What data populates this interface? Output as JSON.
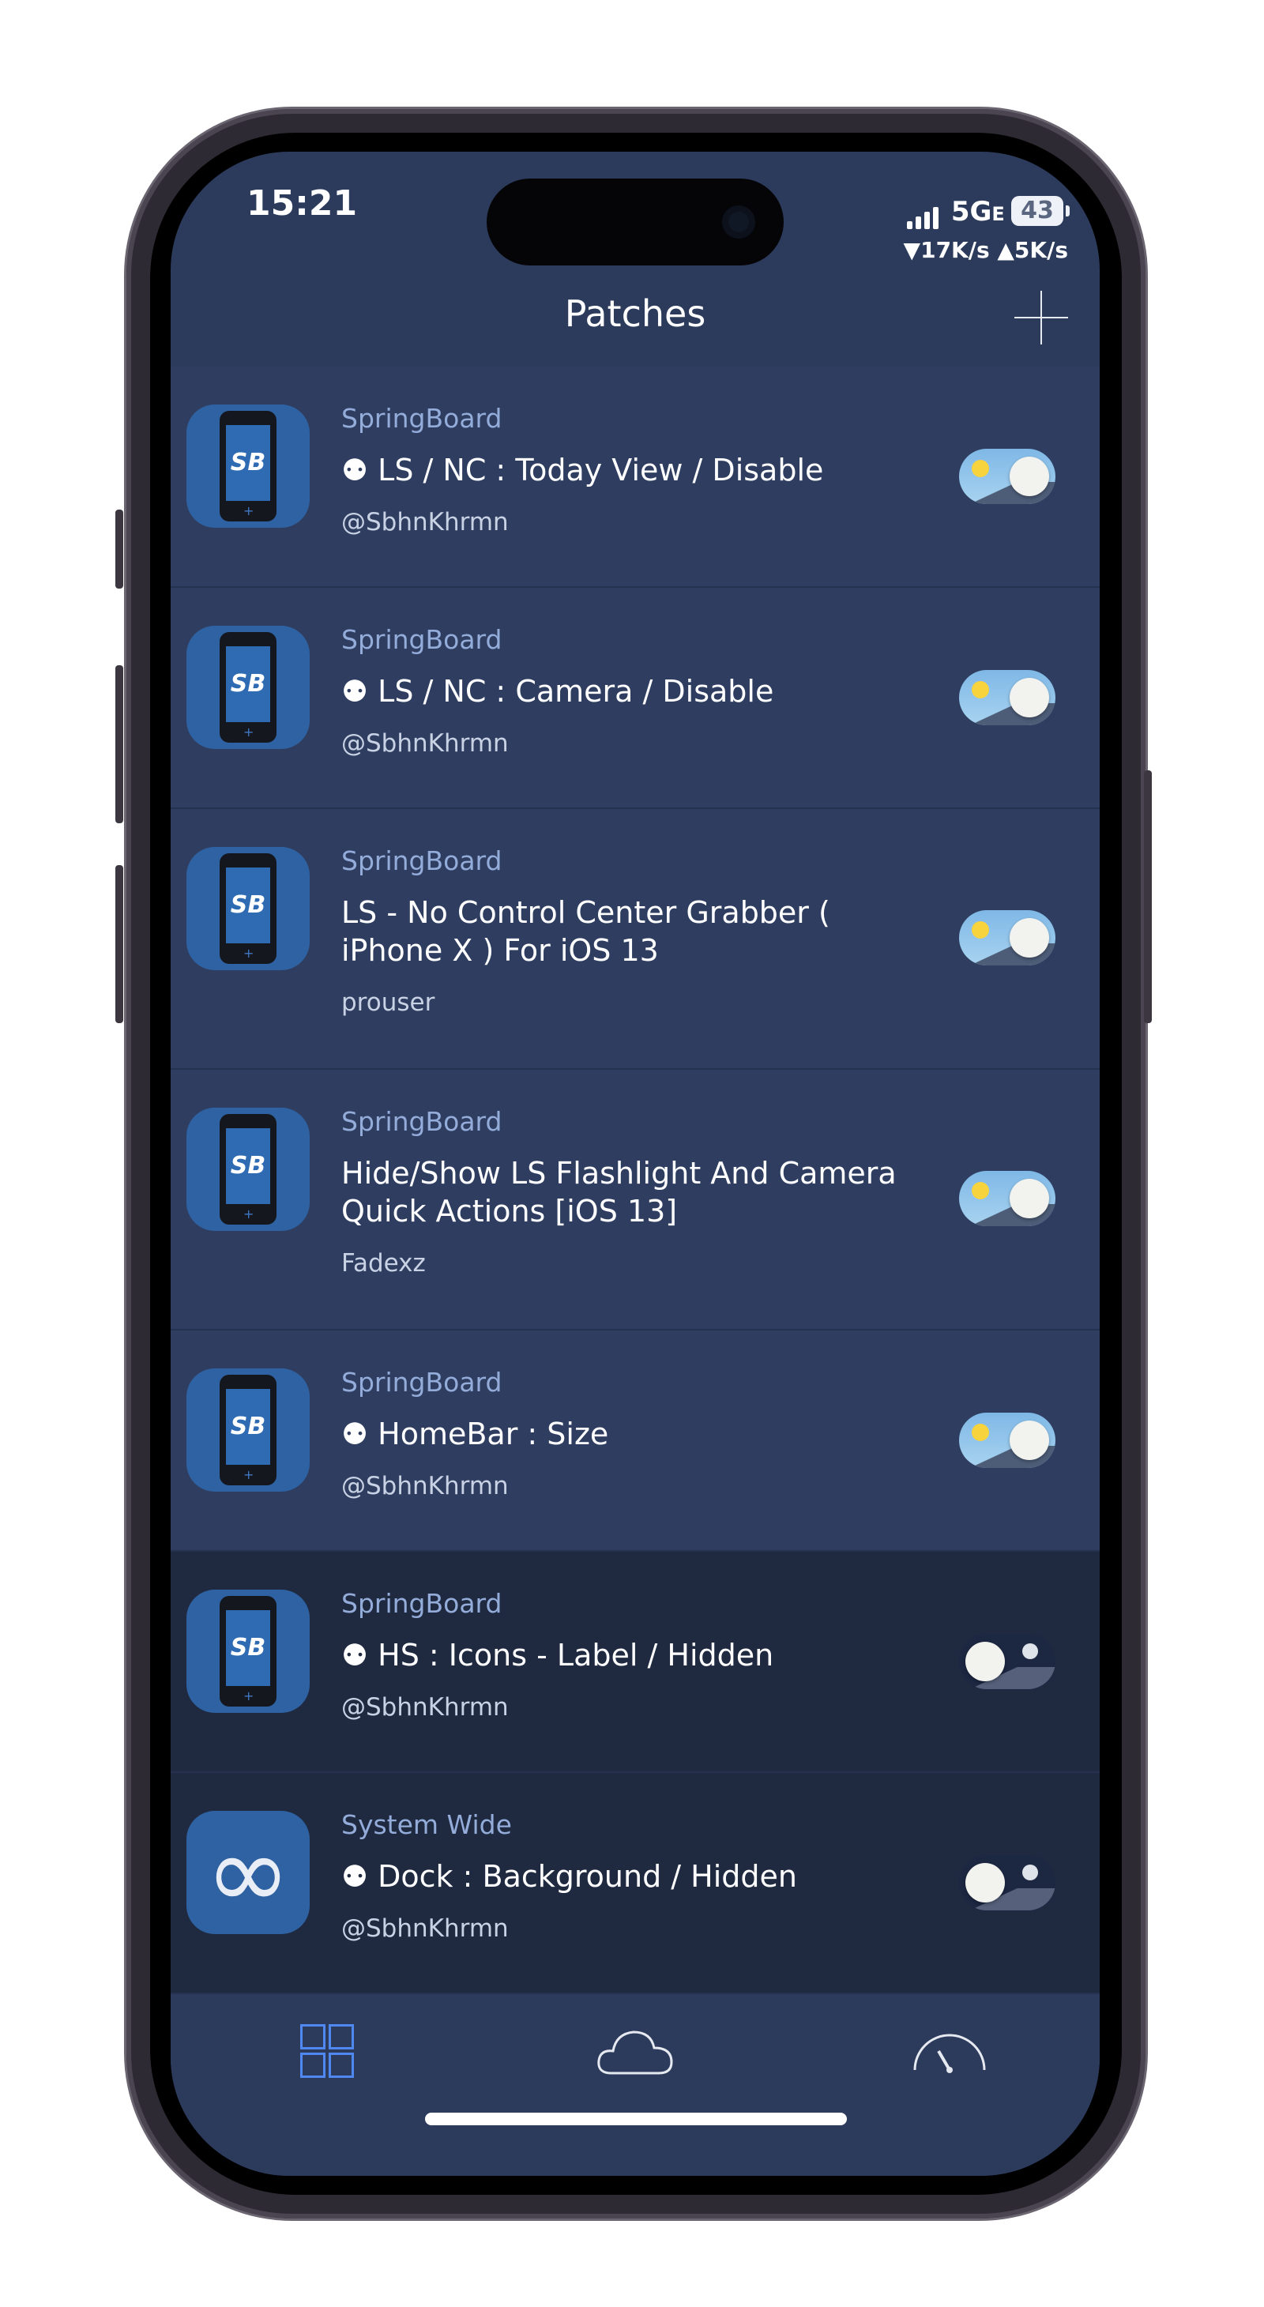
{
  "status": {
    "time": "15:21",
    "network": "5G",
    "network_sub": "E",
    "battery": "43",
    "speed": "▼17K/s ▲5K/s"
  },
  "header": {
    "title": "Patches",
    "add_icon": "plus-icon"
  },
  "patches": [
    {
      "category": "SpringBoard",
      "name": "⚉ LS / NC : Today View / Disable",
      "author": "@SbhnKhrmn",
      "icon": "SB",
      "enabled": true
    },
    {
      "category": "SpringBoard",
      "name": "⚉ LS / NC : Camera / Disable",
      "author": "@SbhnKhrmn",
      "icon": "SB",
      "enabled": true
    },
    {
      "category": "SpringBoard",
      "name": "LS - No Control Center Grabber ( iPhone X ) For iOS 13",
      "author": "prouser",
      "icon": "SB",
      "enabled": true
    },
    {
      "category": "SpringBoard",
      "name": "Hide/Show LS Flashlight And Camera Quick Actions [iOS 13]",
      "author": "Fadexz",
      "icon": "SB",
      "enabled": true
    },
    {
      "category": "SpringBoard",
      "name": "⚉ HomeBar : Size",
      "author": "@SbhnKhrmn",
      "icon": "SB",
      "enabled": true
    },
    {
      "category": "SpringBoard",
      "name": "⚉ HS : Icons - Label / Hidden",
      "author": "@SbhnKhrmn",
      "icon": "SB",
      "enabled": false
    },
    {
      "category": "System Wide",
      "name": "⚉ Dock : Background / Hidden",
      "author": "@SbhnKhrmn",
      "icon": "∞",
      "enabled": false
    }
  ],
  "tabs": [
    {
      "icon": "grid-icon",
      "active": true
    },
    {
      "icon": "cloud-icon",
      "active": false
    },
    {
      "icon": "gauge-icon",
      "active": false
    }
  ]
}
